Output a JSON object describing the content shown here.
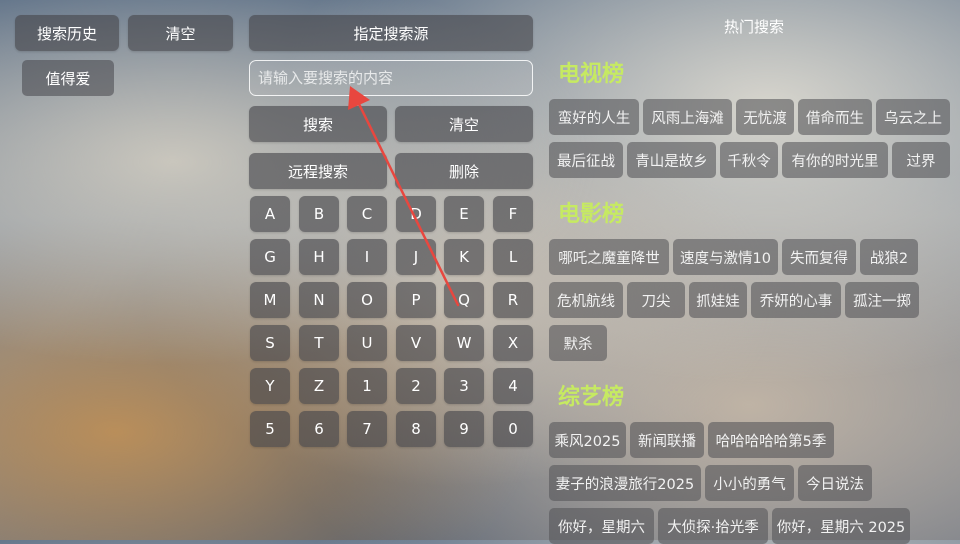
{
  "left_panel": {
    "history_button": "搜索历史",
    "clear_button": "清空",
    "history_items": [
      "值得爱"
    ]
  },
  "middle_panel": {
    "source_button": "指定搜索源",
    "search_placeholder": "请输入要搜索的内容",
    "search_button": "搜索",
    "clear_button": "清空",
    "remote_search_button": "远程搜索",
    "delete_button": "删除",
    "keys": [
      "A",
      "B",
      "C",
      "D",
      "E",
      "F",
      "G",
      "H",
      "I",
      "J",
      "K",
      "L",
      "M",
      "N",
      "O",
      "P",
      "Q",
      "R",
      "S",
      "T",
      "U",
      "V",
      "W",
      "X",
      "Y",
      "Z",
      "1",
      "2",
      "3",
      "4",
      "5",
      "6",
      "7",
      "8",
      "9",
      "0"
    ]
  },
  "right_panel": {
    "title": "热门搜索",
    "tv": {
      "title": "电视榜",
      "row1": [
        "蛮好的人生",
        "风雨上海滩",
        "无忧渡",
        "借命而生",
        "乌云之上"
      ],
      "row2": [
        "最后征战",
        "青山是故乡",
        "千秋令",
        "有你的时光里",
        "过界"
      ]
    },
    "movie": {
      "title": "电影榜",
      "row1": [
        "哪吒之魔童降世",
        "速度与激情10",
        "失而复得",
        "战狼2"
      ],
      "row2": [
        "危机航线",
        "刀尖",
        "抓娃娃",
        "乔妍的心事",
        "孤注一掷"
      ],
      "row3": [
        "默杀"
      ]
    },
    "variety": {
      "title": "综艺榜",
      "row1": [
        "乘风2025",
        "新闻联播",
        "哈哈哈哈哈第5季"
      ],
      "row2": [
        "妻子的浪漫旅行2025",
        "小小的勇气",
        "今日说法"
      ],
      "row3": [
        "你好，星期六",
        "大侦探·拾光季",
        "你好，星期六 2025"
      ]
    }
  },
  "colors": {
    "section_title": "#c6ea62",
    "annotation_arrow": "#e8473f"
  }
}
